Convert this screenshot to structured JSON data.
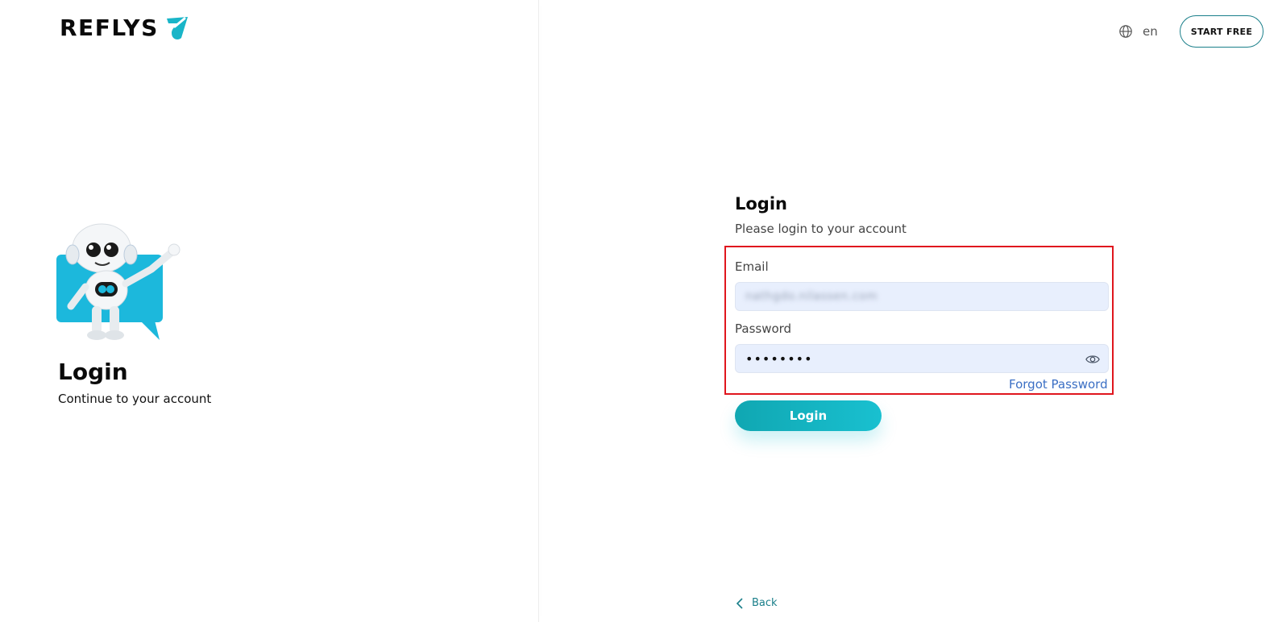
{
  "brand": {
    "name": "REFLYS",
    "accent_color": "#19c0d0"
  },
  "header": {
    "language": {
      "icon": "globe-icon",
      "label": "en"
    },
    "start_free_label": "START FREE"
  },
  "left_panel": {
    "illustration": "robot-mascot",
    "title": "Login",
    "subtitle": "Continue to your account"
  },
  "form": {
    "title": "Login",
    "subtitle": "Please login to your account",
    "email": {
      "label": "Email",
      "value": "nathgdo.nilassen.com"
    },
    "password": {
      "label": "Password",
      "value": "••••••••",
      "toggle_icon": "eye-icon"
    },
    "forgot_password_label": "Forgot Password",
    "login_button_label": "Login",
    "highlight_color": "#e0161e"
  },
  "footer": {
    "back_label": "Back",
    "back_icon": "chevron-left-icon"
  }
}
